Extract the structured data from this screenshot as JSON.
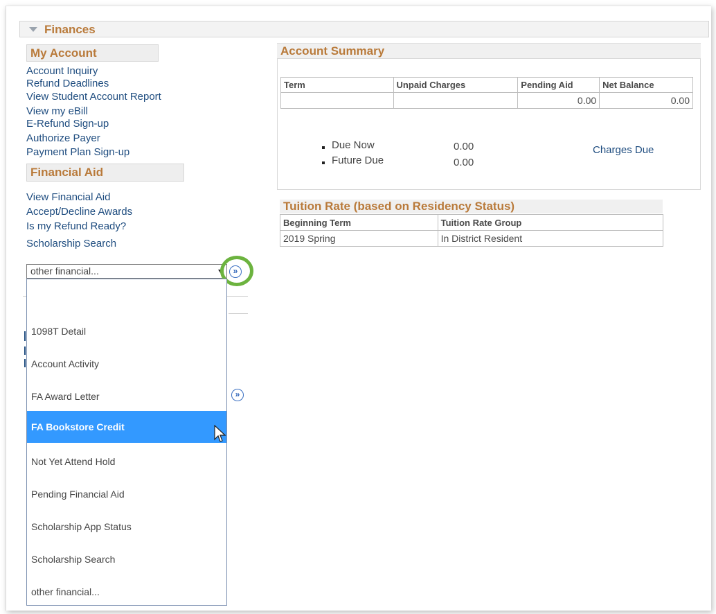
{
  "finances": {
    "title": "Finances"
  },
  "my_account": {
    "header": "My Account",
    "links": [
      "Account Inquiry",
      "Refund Deadlines",
      "View Student Account Report",
      "View my eBill",
      "E-Refund Sign-up",
      "Authorize Payer",
      "Payment Plan Sign-up"
    ]
  },
  "financial_aid": {
    "header": "Financial Aid",
    "links": [
      "View Financial Aid",
      "Accept/Decline Awards",
      "Is my Refund Ready?",
      "Scholarship Search"
    ]
  },
  "other_select": {
    "selected": "other financial...",
    "options": [
      "",
      "1098T Detail",
      "Account Activity",
      "FA Award Letter",
      "FA Bookstore Credit",
      "Not Yet Attend Hold",
      "Pending Financial Aid",
      "Scholarship App Status",
      "Scholarship Search",
      "other financial..."
    ],
    "highlighted": "FA Bookstore Credit",
    "go_glyph": "»"
  },
  "account_summary": {
    "header": "Account Summary",
    "columns": [
      "Term",
      "Unpaid Charges",
      "Pending Aid",
      "Net Balance"
    ],
    "row": [
      "",
      "",
      "0.00",
      "0.00"
    ],
    "due": [
      {
        "label": "Due Now",
        "amount": "0.00"
      },
      {
        "label": "Future Due",
        "amount": "0.00"
      }
    ],
    "charges_due_link": "Charges Due"
  },
  "tuition_rate": {
    "header": "Tuition Rate (based on Residency Status)",
    "columns": [
      "Beginning Term",
      "Tuition Rate Group"
    ],
    "row": [
      "2019 Spring",
      "In District Resident"
    ]
  },
  "colors": {
    "heading": "#b97a3a",
    "link": "#1e4c7f",
    "selected": "#3399ff",
    "highlight_ring": "#6cb33f"
  }
}
